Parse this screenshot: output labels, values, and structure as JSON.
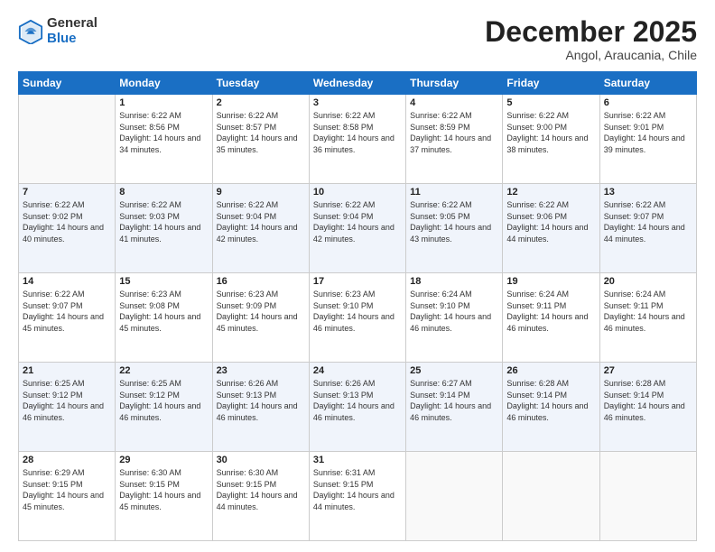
{
  "logo": {
    "general": "General",
    "blue": "Blue"
  },
  "header": {
    "month": "December 2025",
    "location": "Angol, Araucania, Chile"
  },
  "days": [
    "Sunday",
    "Monday",
    "Tuesday",
    "Wednesday",
    "Thursday",
    "Friday",
    "Saturday"
  ],
  "weeks": [
    [
      {
        "date": "",
        "sunrise": "",
        "sunset": "",
        "daylight": ""
      },
      {
        "date": "1",
        "sunrise": "Sunrise: 6:22 AM",
        "sunset": "Sunset: 8:56 PM",
        "daylight": "Daylight: 14 hours and 34 minutes."
      },
      {
        "date": "2",
        "sunrise": "Sunrise: 6:22 AM",
        "sunset": "Sunset: 8:57 PM",
        "daylight": "Daylight: 14 hours and 35 minutes."
      },
      {
        "date": "3",
        "sunrise": "Sunrise: 6:22 AM",
        "sunset": "Sunset: 8:58 PM",
        "daylight": "Daylight: 14 hours and 36 minutes."
      },
      {
        "date": "4",
        "sunrise": "Sunrise: 6:22 AM",
        "sunset": "Sunset: 8:59 PM",
        "daylight": "Daylight: 14 hours and 37 minutes."
      },
      {
        "date": "5",
        "sunrise": "Sunrise: 6:22 AM",
        "sunset": "Sunset: 9:00 PM",
        "daylight": "Daylight: 14 hours and 38 minutes."
      },
      {
        "date": "6",
        "sunrise": "Sunrise: 6:22 AM",
        "sunset": "Sunset: 9:01 PM",
        "daylight": "Daylight: 14 hours and 39 minutes."
      }
    ],
    [
      {
        "date": "7",
        "sunrise": "Sunrise: 6:22 AM",
        "sunset": "Sunset: 9:02 PM",
        "daylight": "Daylight: 14 hours and 40 minutes."
      },
      {
        "date": "8",
        "sunrise": "Sunrise: 6:22 AM",
        "sunset": "Sunset: 9:03 PM",
        "daylight": "Daylight: 14 hours and 41 minutes."
      },
      {
        "date": "9",
        "sunrise": "Sunrise: 6:22 AM",
        "sunset": "Sunset: 9:04 PM",
        "daylight": "Daylight: 14 hours and 42 minutes."
      },
      {
        "date": "10",
        "sunrise": "Sunrise: 6:22 AM",
        "sunset": "Sunset: 9:04 PM",
        "daylight": "Daylight: 14 hours and 42 minutes."
      },
      {
        "date": "11",
        "sunrise": "Sunrise: 6:22 AM",
        "sunset": "Sunset: 9:05 PM",
        "daylight": "Daylight: 14 hours and 43 minutes."
      },
      {
        "date": "12",
        "sunrise": "Sunrise: 6:22 AM",
        "sunset": "Sunset: 9:06 PM",
        "daylight": "Daylight: 14 hours and 44 minutes."
      },
      {
        "date": "13",
        "sunrise": "Sunrise: 6:22 AM",
        "sunset": "Sunset: 9:07 PM",
        "daylight": "Daylight: 14 hours and 44 minutes."
      }
    ],
    [
      {
        "date": "14",
        "sunrise": "Sunrise: 6:22 AM",
        "sunset": "Sunset: 9:07 PM",
        "daylight": "Daylight: 14 hours and 45 minutes."
      },
      {
        "date": "15",
        "sunrise": "Sunrise: 6:23 AM",
        "sunset": "Sunset: 9:08 PM",
        "daylight": "Daylight: 14 hours and 45 minutes."
      },
      {
        "date": "16",
        "sunrise": "Sunrise: 6:23 AM",
        "sunset": "Sunset: 9:09 PM",
        "daylight": "Daylight: 14 hours and 45 minutes."
      },
      {
        "date": "17",
        "sunrise": "Sunrise: 6:23 AM",
        "sunset": "Sunset: 9:10 PM",
        "daylight": "Daylight: 14 hours and 46 minutes."
      },
      {
        "date": "18",
        "sunrise": "Sunrise: 6:24 AM",
        "sunset": "Sunset: 9:10 PM",
        "daylight": "Daylight: 14 hours and 46 minutes."
      },
      {
        "date": "19",
        "sunrise": "Sunrise: 6:24 AM",
        "sunset": "Sunset: 9:11 PM",
        "daylight": "Daylight: 14 hours and 46 minutes."
      },
      {
        "date": "20",
        "sunrise": "Sunrise: 6:24 AM",
        "sunset": "Sunset: 9:11 PM",
        "daylight": "Daylight: 14 hours and 46 minutes."
      }
    ],
    [
      {
        "date": "21",
        "sunrise": "Sunrise: 6:25 AM",
        "sunset": "Sunset: 9:12 PM",
        "daylight": "Daylight: 14 hours and 46 minutes."
      },
      {
        "date": "22",
        "sunrise": "Sunrise: 6:25 AM",
        "sunset": "Sunset: 9:12 PM",
        "daylight": "Daylight: 14 hours and 46 minutes."
      },
      {
        "date": "23",
        "sunrise": "Sunrise: 6:26 AM",
        "sunset": "Sunset: 9:13 PM",
        "daylight": "Daylight: 14 hours and 46 minutes."
      },
      {
        "date": "24",
        "sunrise": "Sunrise: 6:26 AM",
        "sunset": "Sunset: 9:13 PM",
        "daylight": "Daylight: 14 hours and 46 minutes."
      },
      {
        "date": "25",
        "sunrise": "Sunrise: 6:27 AM",
        "sunset": "Sunset: 9:14 PM",
        "daylight": "Daylight: 14 hours and 46 minutes."
      },
      {
        "date": "26",
        "sunrise": "Sunrise: 6:28 AM",
        "sunset": "Sunset: 9:14 PM",
        "daylight": "Daylight: 14 hours and 46 minutes."
      },
      {
        "date": "27",
        "sunrise": "Sunrise: 6:28 AM",
        "sunset": "Sunset: 9:14 PM",
        "daylight": "Daylight: 14 hours and 46 minutes."
      }
    ],
    [
      {
        "date": "28",
        "sunrise": "Sunrise: 6:29 AM",
        "sunset": "Sunset: 9:15 PM",
        "daylight": "Daylight: 14 hours and 45 minutes."
      },
      {
        "date": "29",
        "sunrise": "Sunrise: 6:30 AM",
        "sunset": "Sunset: 9:15 PM",
        "daylight": "Daylight: 14 hours and 45 minutes."
      },
      {
        "date": "30",
        "sunrise": "Sunrise: 6:30 AM",
        "sunset": "Sunset: 9:15 PM",
        "daylight": "Daylight: 14 hours and 44 minutes."
      },
      {
        "date": "31",
        "sunrise": "Sunrise: 6:31 AM",
        "sunset": "Sunset: 9:15 PM",
        "daylight": "Daylight: 14 hours and 44 minutes."
      },
      {
        "date": "",
        "sunrise": "",
        "sunset": "",
        "daylight": ""
      },
      {
        "date": "",
        "sunrise": "",
        "sunset": "",
        "daylight": ""
      },
      {
        "date": "",
        "sunrise": "",
        "sunset": "",
        "daylight": ""
      }
    ]
  ]
}
